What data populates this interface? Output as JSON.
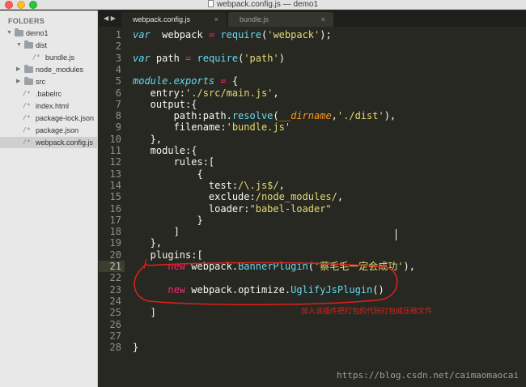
{
  "window": {
    "title": "webpack.config.js — demo1"
  },
  "sidebar": {
    "heading": "FOLDERS",
    "items": [
      {
        "label": "demo1",
        "type": "folder",
        "depth": 0,
        "expanded": true
      },
      {
        "label": "dist",
        "type": "folder",
        "depth": 1,
        "expanded": true
      },
      {
        "label": "bundle.js",
        "type": "file",
        "depth": 2
      },
      {
        "label": "node_modules",
        "type": "folder",
        "depth": 1,
        "expanded": false
      },
      {
        "label": "src",
        "type": "folder",
        "depth": 1,
        "expanded": false
      },
      {
        "label": ".babelrc",
        "type": "file",
        "depth": 1
      },
      {
        "label": "index.html",
        "type": "file",
        "depth": 1
      },
      {
        "label": "package-lock.json",
        "type": "file",
        "depth": 1
      },
      {
        "label": "package.json",
        "type": "file",
        "depth": 1
      },
      {
        "label": "webpack.config.js",
        "type": "file",
        "depth": 1,
        "selected": true
      }
    ]
  },
  "tabs": [
    {
      "label": "webpack.config.js",
      "active": true
    },
    {
      "label": "bundle.js",
      "active": false
    }
  ],
  "editor": {
    "highlighted_line": 21,
    "lines": [
      [
        [
          "k",
          "var"
        ],
        [
          "",
          "  webpack "
        ],
        [
          "o",
          "="
        ],
        [
          "",
          " "
        ],
        [
          "f",
          "require"
        ],
        [
          "",
          "("
        ],
        [
          "s",
          "'webpack'"
        ],
        [
          "",
          ");"
        ]
      ],
      [],
      [
        [
          "k",
          "var"
        ],
        [
          "",
          " path "
        ],
        [
          "o",
          "="
        ],
        [
          "",
          " "
        ],
        [
          "f",
          "require"
        ],
        [
          "",
          "("
        ],
        [
          "s",
          "'path'"
        ],
        [
          "",
          ")"
        ]
      ],
      [],
      [
        [
          "mo",
          "module"
        ],
        [
          "",
          ""
        ],
        [
          "mo",
          ".exports"
        ],
        [
          "",
          " "
        ],
        [
          "o",
          "="
        ],
        [
          "",
          " {"
        ]
      ],
      [
        [
          "",
          "   entry:"
        ],
        [
          "s",
          "'./src/main.js'"
        ],
        [
          "",
          ","
        ]
      ],
      [
        [
          "",
          "   output:{"
        ]
      ],
      [
        [
          "",
          "       path:path."
        ],
        [
          "f",
          "resolve"
        ],
        [
          "",
          "("
        ],
        [
          "p",
          "__dirname"
        ],
        [
          "",
          ","
        ],
        [
          "s",
          "'./dist'"
        ],
        [
          "",
          "),"
        ]
      ],
      [
        [
          "",
          "       filename:"
        ],
        [
          "s",
          "'bundle.js'"
        ]
      ],
      [
        [
          "",
          "   },"
        ]
      ],
      [
        [
          "",
          "   module:{"
        ]
      ],
      [
        [
          "",
          "       rules:["
        ]
      ],
      [
        [
          "",
          "           {"
        ]
      ],
      [
        [
          "",
          "             test:"
        ],
        [
          "s",
          "/\\.js$/"
        ],
        [
          "",
          ","
        ]
      ],
      [
        [
          "",
          "             exclude:"
        ],
        [
          "s",
          "/node_modules/"
        ],
        [
          "",
          ","
        ]
      ],
      [
        [
          "",
          "             loader:"
        ],
        [
          "s",
          "\"babel-loader\""
        ]
      ],
      [
        [
          "",
          "           }"
        ]
      ],
      [
        [
          "",
          "       ]"
        ]
      ],
      [
        [
          "",
          "   },"
        ]
      ],
      [
        [
          "",
          "   plugins:["
        ]
      ],
      [
        [
          "",
          "      "
        ],
        [
          "o",
          "new"
        ],
        [
          "",
          " webpack."
        ],
        [
          "f",
          "BannerPlugin"
        ],
        [
          "",
          "("
        ],
        [
          "s",
          "'蔡毛毛一定会成功'"
        ],
        [
          "",
          "),"
        ]
      ],
      [],
      [
        [
          "",
          "      "
        ],
        [
          "o",
          "new"
        ],
        [
          "",
          " webpack.optimize."
        ],
        [
          "f",
          "UglifyJsPlugin"
        ],
        [
          "",
          "()"
        ]
      ],
      [],
      [
        [
          "",
          "   ]"
        ]
      ],
      [],
      [],
      [
        [
          "",
          "}"
        ]
      ]
    ]
  },
  "annotation": {
    "text": "加入该插件把打包的代码打包成压缩文件",
    "color": "#e0201b"
  },
  "watermark": "https://blog.csdn.net/caimaomaocai",
  "colors": {
    "editor_bg": "#272822",
    "sidebar_bg": "#e8e8e8",
    "string": "#e6db74",
    "keyword": "#f92672",
    "function": "#66d9ef",
    "annotation": "#e0201b"
  }
}
